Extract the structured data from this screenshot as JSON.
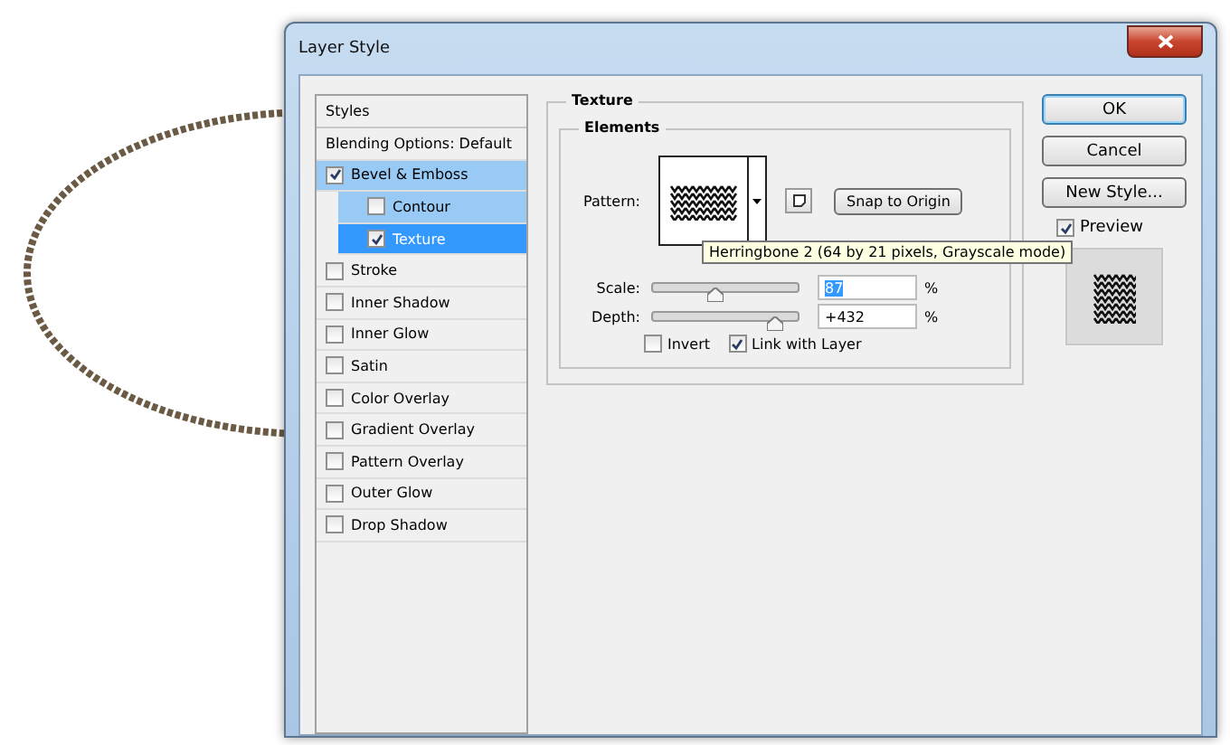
{
  "window": {
    "title": "Layer Style"
  },
  "styles": {
    "header": "Styles",
    "items": [
      {
        "label": "Blending Options: Default",
        "kind": "plain",
        "selected": false
      },
      {
        "label": "Bevel & Emboss",
        "kind": "check",
        "checked": true,
        "selected": false,
        "highlighted": true,
        "children": [
          {
            "label": "Contour",
            "kind": "check",
            "checked": false,
            "selected": false,
            "highlighted": true
          },
          {
            "label": "Texture",
            "kind": "check",
            "checked": true,
            "selected": true,
            "highlighted": true
          }
        ]
      },
      {
        "label": "Stroke",
        "kind": "check",
        "checked": false,
        "selected": false
      },
      {
        "label": "Inner Shadow",
        "kind": "check",
        "checked": false,
        "selected": false
      },
      {
        "label": "Inner Glow",
        "kind": "check",
        "checked": false,
        "selected": false
      },
      {
        "label": "Satin",
        "kind": "check",
        "checked": false,
        "selected": false
      },
      {
        "label": "Color Overlay",
        "kind": "check",
        "checked": false,
        "selected": false
      },
      {
        "label": "Gradient Overlay",
        "kind": "check",
        "checked": false,
        "selected": false
      },
      {
        "label": "Pattern Overlay",
        "kind": "check",
        "checked": false,
        "selected": false
      },
      {
        "label": "Outer Glow",
        "kind": "check",
        "checked": false,
        "selected": false
      },
      {
        "label": "Drop Shadow",
        "kind": "check",
        "checked": false,
        "selected": false
      }
    ]
  },
  "texture": {
    "title": "Texture",
    "group": "Elements",
    "pattern_label": "Pattern:",
    "snap_button": "Snap to Origin",
    "tooltip": "Herringbone 2 (64 by 21 pixels, Grayscale mode)",
    "sliders": [
      {
        "label": "Scale:",
        "level": 0.43,
        "value": "87",
        "unit": "%",
        "focused": true
      },
      {
        "label": "Depth:",
        "level": 0.84,
        "value": "+432",
        "unit": "%",
        "focused": false
      }
    ],
    "options": [
      {
        "label": "Invert",
        "checked": false
      },
      {
        "label": "Link with Layer",
        "checked": true
      }
    ]
  },
  "buttons": [
    {
      "label": "OK",
      "default": true
    },
    {
      "label": "Cancel",
      "default": false
    },
    {
      "label": "New Style...",
      "default": false
    }
  ],
  "preview": {
    "label": "Preview",
    "checked": true
  }
}
